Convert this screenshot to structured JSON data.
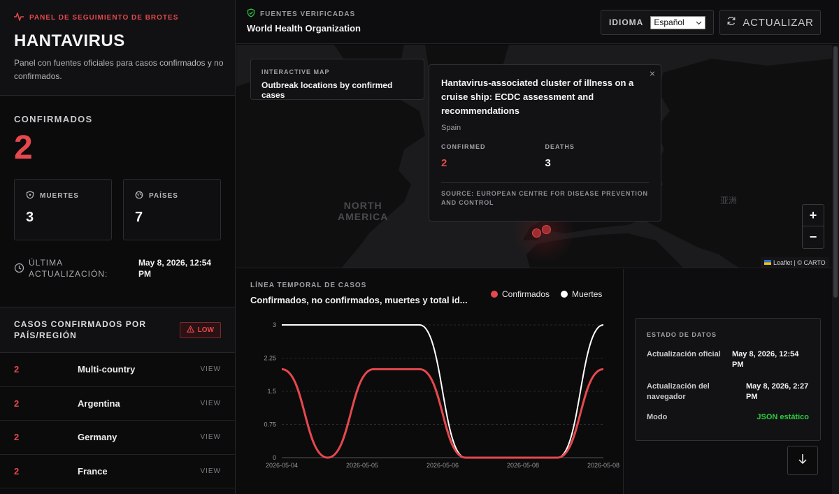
{
  "brand": {
    "kicker": "PANEL DE SEGUIMIENTO DE BROTES",
    "title": "HANTAVIRUS",
    "description": "Panel con fuentes oficiales para casos confirmados y no confirmados."
  },
  "stats": {
    "confirmed_label": "CONFIRMADOS",
    "confirmed_value": "2",
    "deaths_label": "MUERTES",
    "deaths_value": "3",
    "countries_label": "PAÍSES",
    "countries_value": "7",
    "updated_label": "ÚLTIMA ACTUALIZACIÓN:",
    "updated_value": "May 8, 2026, 12:54 PM"
  },
  "cases": {
    "title": "CASOS CONFIRMADOS POR PAÍS/REGIÓN",
    "badge": "LOW",
    "view_label": "VIEW",
    "rows": [
      {
        "count": "2",
        "country": "Multi-country"
      },
      {
        "count": "2",
        "country": "Argentina"
      },
      {
        "count": "2",
        "country": "Germany"
      },
      {
        "count": "2",
        "country": "France"
      }
    ]
  },
  "topbar": {
    "source_label": "FUENTES VERIFICADAS",
    "source_name": "World Health Organization",
    "language_label": "IDIOMA",
    "language_value": "Español",
    "refresh_label": "ACTUALIZAR"
  },
  "map": {
    "card_label": "INTERACTIVE MAP",
    "card_title": "Outbreak locations by confirmed cases",
    "region_label_line1": "NORTH",
    "region_label_line2": "AMERICA",
    "asia_label": "亚洲",
    "zoom_in": "+",
    "zoom_out": "−",
    "attribution": "Leaflet | © CARTO",
    "popup": {
      "title": "Hantavirus-associated cluster of illness on a cruise ship: ECDC assessment and recommendations",
      "location": "Spain",
      "confirmed_label": "CONFIRMED",
      "confirmed_value": "2",
      "deaths_label": "DEATHS",
      "deaths_value": "3",
      "source": "SOURCE: EUROPEAN CENTRE FOR DISEASE PREVENTION AND CONTROL",
      "close": "×"
    }
  },
  "timeline": {
    "kicker": "LÍNEA TEMPORAL DE CASOS",
    "title": "Confirmados, no confirmados, muertes y total id...",
    "colors": {
      "confirmed": "#e5484d",
      "deaths": "#ffffff"
    }
  },
  "chart_data": {
    "type": "line",
    "categories": [
      "2026-05-04",
      "2026-05-05",
      "2026-05-05",
      "2026-05-06",
      "2026-05-06",
      "2026-05-08",
      "2026-05-08",
      "2026-05-08"
    ],
    "x_tick_labels": [
      "2026-05-04",
      "2026-05-05",
      "2026-05-06",
      "2026-05-08",
      "2026-05-08"
    ],
    "series": [
      {
        "name": "Confirmados",
        "values": [
          2,
          0,
          2,
          2,
          0,
          0,
          0,
          2
        ]
      },
      {
        "name": "Muertes",
        "values": [
          3,
          3,
          3,
          3,
          0,
          0,
          0,
          3
        ]
      }
    ],
    "ylim": [
      0,
      3
    ],
    "y_ticks": [
      "0",
      "0.75",
      "1.5",
      "2.25",
      "3"
    ],
    "grid": true,
    "legend": "top-right"
  },
  "status": {
    "title": "ESTADO DE DATOS",
    "official_label": "Actualización oficial",
    "official_value": "May 8, 2026, 12:54 PM",
    "browser_label": "Actualización del navegador",
    "browser_value": "May 8, 2026, 2:27 PM",
    "mode_label": "Modo",
    "mode_value": "JSON estático"
  }
}
